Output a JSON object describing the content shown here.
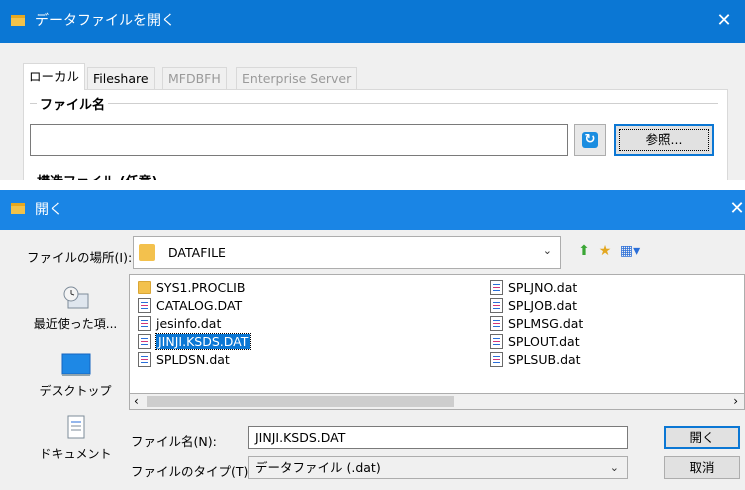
{
  "window1": {
    "title": "データファイルを開く",
    "close_glyph": "✕",
    "tabs": [
      {
        "label": "ローカル",
        "state": "active"
      },
      {
        "label": "Fileshare",
        "state": "normal"
      },
      {
        "label": "MFDBFH",
        "state": "disabled"
      },
      {
        "label": "Enterprise Server",
        "state": "disabled"
      }
    ],
    "group_label": "ファイル名",
    "filename_value": "",
    "refresh_icon": "refresh-icon",
    "browse_label": "参照...",
    "cutoff_label": "構造ファイル (任意)"
  },
  "window2": {
    "title": "開く",
    "close_glyph": "✕",
    "lookin_label": "ファイルの場所(I):",
    "lookin_value": "DATAFILE",
    "toolbar_icons": [
      "up-folder-icon",
      "new-folder-icon",
      "view-menu-icon"
    ],
    "places": [
      {
        "label": "最近使った項...",
        "icon": "recent-items-icon"
      },
      {
        "label": "デスクトップ",
        "icon": "desktop-icon"
      },
      {
        "label": "ドキュメント",
        "icon": "documents-icon"
      }
    ],
    "files_col1": [
      {
        "name": "SYS1.PROCLIB",
        "type": "folder"
      },
      {
        "name": "CATALOG.DAT",
        "type": "file"
      },
      {
        "name": "jesinfo.dat",
        "type": "file"
      },
      {
        "name": "JINJI.KSDS.DAT",
        "type": "file",
        "selected": true
      },
      {
        "name": "SPLDSN.dat",
        "type": "file"
      }
    ],
    "files_col2": [
      {
        "name": "SPLJNO.dat",
        "type": "file"
      },
      {
        "name": "SPLJOB.dat",
        "type": "file"
      },
      {
        "name": "SPLMSG.dat",
        "type": "file"
      },
      {
        "name": "SPLOUT.dat",
        "type": "file"
      },
      {
        "name": "SPLSUB.dat",
        "type": "file"
      }
    ],
    "filename_label": "ファイル名(N):",
    "filename_value": "JINJI.KSDS.DAT",
    "filetype_label": "ファイルのタイプ(T):",
    "filetype_value": "データファイル (.dat)",
    "open_button": "開く",
    "cancel_button": "取消"
  },
  "colors": {
    "titlebar": "#0b77d4",
    "selection": "#0b77d4",
    "folder": "#f3c14d"
  }
}
